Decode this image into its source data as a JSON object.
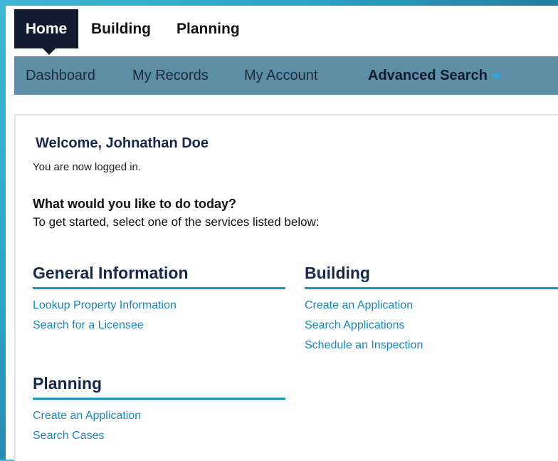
{
  "top_tabs": [
    "Home",
    "Building",
    "Planning"
  ],
  "subnav": {
    "dashboard": "Dashboard",
    "my_records": "My Records",
    "my_account": "My Account",
    "advanced_search": "Advanced Search"
  },
  "welcome": "Welcome, Johnathan Doe",
  "logged_in": "You are now logged in.",
  "question": "What would you like to do today?",
  "get_started": "To get started, select one of the services listed below:",
  "sections": {
    "general": {
      "title": "General Information",
      "links": [
        "Lookup Property Information",
        "Search for a Licensee"
      ]
    },
    "building": {
      "title": "Building",
      "links": [
        "Create an Application",
        "Search Applications",
        "Schedule an Inspection"
      ]
    },
    "planning": {
      "title": "Planning",
      "links": [
        "Create an Application",
        "Search Cases"
      ]
    }
  },
  "colors": {
    "active_tab": "#121b2f",
    "subnav_bg": "#5e8ea6",
    "link": "#1a86b8",
    "section_rule": "#1e91c5",
    "heading": "#15294a"
  }
}
